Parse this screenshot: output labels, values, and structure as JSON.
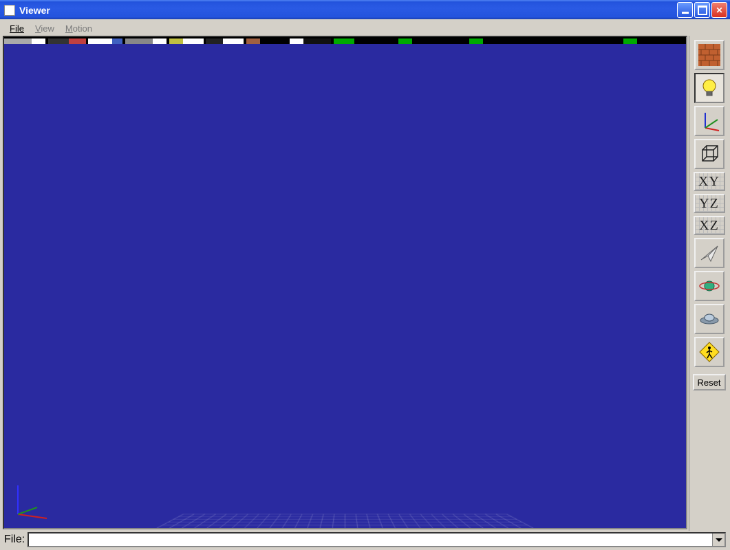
{
  "window": {
    "title": "Viewer"
  },
  "menu": {
    "items": [
      {
        "label": "File",
        "enabled": true
      },
      {
        "label": "View",
        "enabled": false
      },
      {
        "label": "Motion",
        "enabled": false
      }
    ]
  },
  "toolbar": {
    "buttons": [
      {
        "name": "texture-button",
        "icon": "brick-wall-icon",
        "pressed": false,
        "label": ""
      },
      {
        "name": "lighting-button",
        "icon": "lightbulb-icon",
        "pressed": true,
        "label": ""
      },
      {
        "name": "axes-button",
        "icon": "axes-icon",
        "pressed": false,
        "label": ""
      },
      {
        "name": "wireframe-button",
        "icon": "cube-wire-icon",
        "pressed": false,
        "label": ""
      },
      {
        "name": "view-xy-button",
        "icon": "grid-label-icon",
        "pressed": false,
        "label": "XY"
      },
      {
        "name": "view-yz-button",
        "icon": "grid-label-icon",
        "pressed": false,
        "label": "YZ"
      },
      {
        "name": "view-xz-button",
        "icon": "grid-label-icon",
        "pressed": false,
        "label": "XZ"
      },
      {
        "name": "fly-mode-button",
        "icon": "paper-plane-icon",
        "pressed": false,
        "label": ""
      },
      {
        "name": "orbit-mode-button",
        "icon": "orbit-icon",
        "pressed": false,
        "label": ""
      },
      {
        "name": "ufo-mode-button",
        "icon": "ufo-icon",
        "pressed": false,
        "label": ""
      },
      {
        "name": "walk-mode-button",
        "icon": "pedestrian-icon",
        "pressed": false,
        "label": ""
      }
    ],
    "reset_label": "Reset"
  },
  "file": {
    "label": "File:",
    "value": ""
  },
  "viewport": {
    "background_color": "#2a2aa0",
    "grid_color": "#d0d0e8",
    "grid": {
      "rows": 30,
      "cols": 30
    },
    "axes_colors": {
      "x": "#d02020",
      "y": "#209020",
      "z": "#3030ff"
    }
  }
}
